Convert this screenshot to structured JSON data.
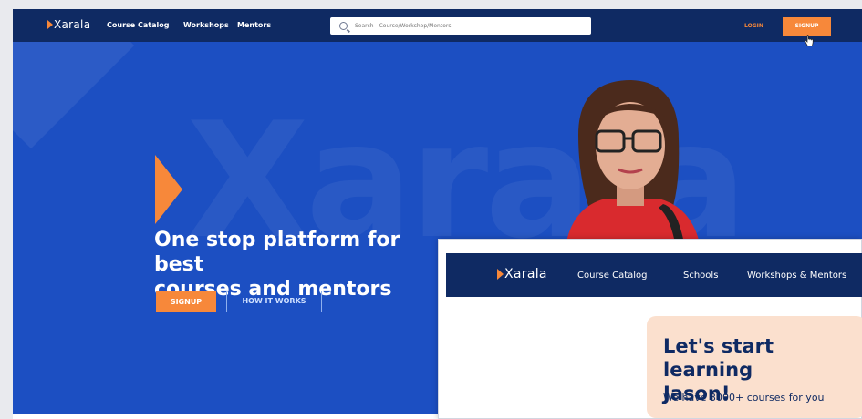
{
  "brand": {
    "name": "Xarala",
    "accent": "#f7883a",
    "nav_bg": "#0f2a63",
    "hero_bg": "#1c4fc2"
  },
  "topnav": {
    "links": [
      "Course Catalog",
      "Workshops",
      "Mentors"
    ],
    "search_placeholder": "Search - Course/Workshop/Mentors",
    "login": "LOGIN",
    "signup": "SIGNUP"
  },
  "hero": {
    "watermark": "Xarala",
    "title_line1": "One stop platform for best",
    "title_line2": "courses and mentors",
    "signup": "SIGNUP",
    "how_it_works": "HOW IT WORKS"
  },
  "overlay": {
    "logo": "Xarala",
    "links": [
      "Course Catalog",
      "Schools",
      "Workshops & Mentors"
    ],
    "welcome_title_line1": "Let's start learning",
    "welcome_title_line2": "Jason!",
    "welcome_sub": "We have 3000+ courses for you"
  }
}
